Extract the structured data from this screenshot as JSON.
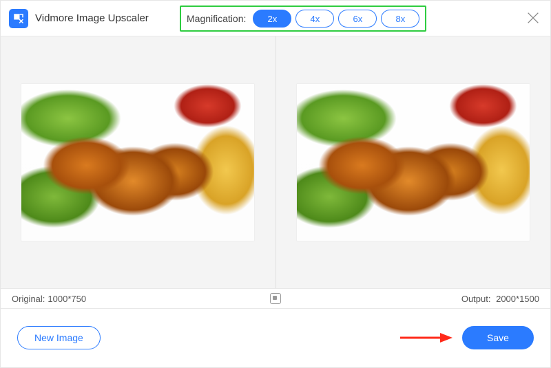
{
  "app": {
    "title": "Vidmore Image Upscaler"
  },
  "magnification": {
    "label": "Magnification:",
    "options": [
      "2x",
      "4x",
      "6x",
      "8x"
    ],
    "active_index": 0
  },
  "info": {
    "original_label": "Original:",
    "original_value": "1000*750",
    "output_label": "Output:",
    "output_value": "2000*1500"
  },
  "footer": {
    "new_image_label": "New Image",
    "save_label": "Save"
  },
  "colors": {
    "accent": "#2b7bff",
    "highlight_box": "#2ecc40",
    "arrow": "#ff2a1a"
  }
}
